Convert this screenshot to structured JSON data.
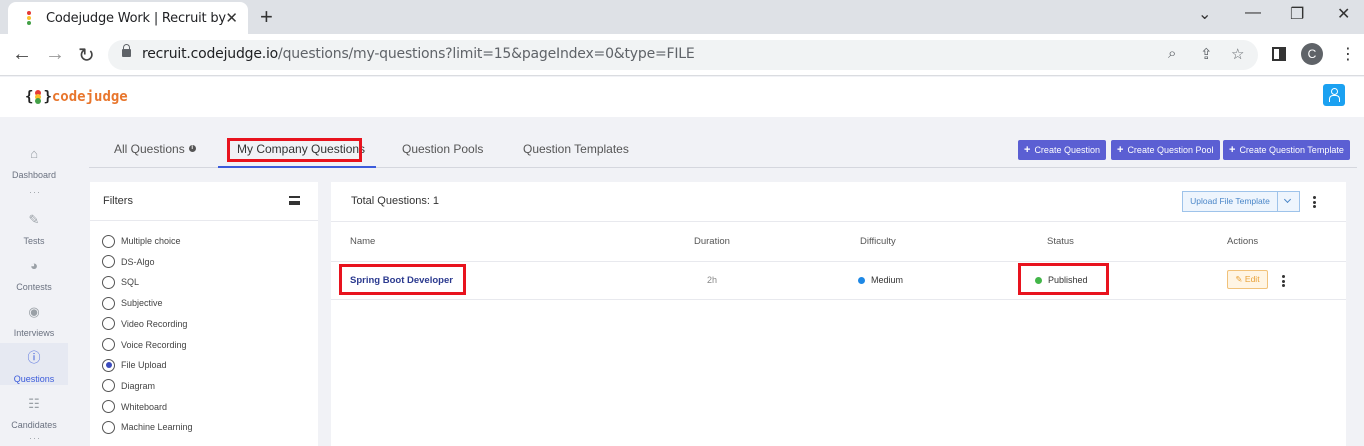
{
  "browser": {
    "tab_title": "Codejudge Work | Recruit by Real",
    "url_host": "recruit.codejudge.io",
    "url_path": "/questions/my-questions?limit=15&pageIndex=0&type=FILE",
    "profile_initial": "C"
  },
  "app": {
    "logo": {
      "brace_open": "{",
      "brace_close": "}",
      "name": "codejudge"
    }
  },
  "sidebar": {
    "items": [
      {
        "label": "Dashboard",
        "icon": "home-icon"
      },
      {
        "label": "Tests",
        "icon": "pencil-icon"
      },
      {
        "label": "Contests",
        "icon": "pie-chart-icon"
      },
      {
        "label": "Interviews",
        "icon": "location-icon"
      },
      {
        "label": "Questions",
        "icon": "question-icon",
        "active": true
      },
      {
        "label": "Candidates",
        "icon": "users-icon"
      }
    ],
    "separator": "···"
  },
  "tabs": {
    "items": [
      "All Questions",
      "My Company Questions",
      "Question Pools",
      "Question Templates"
    ],
    "active": "My Company Questions"
  },
  "actions": {
    "create_question": "Create Question",
    "create_pool": "Create Question Pool",
    "create_template": "Create Question Template",
    "plus": "+"
  },
  "filters": {
    "title": "Filters",
    "options": [
      {
        "label": "Multiple choice",
        "checked": false
      },
      {
        "label": "DS-Algo",
        "checked": false
      },
      {
        "label": "SQL",
        "checked": false
      },
      {
        "label": "Subjective",
        "checked": false
      },
      {
        "label": "Video Recording",
        "checked": false
      },
      {
        "label": "Voice Recording",
        "checked": false
      },
      {
        "label": "File Upload",
        "checked": true
      },
      {
        "label": "Diagram",
        "checked": false
      },
      {
        "label": "Whiteboard",
        "checked": false
      },
      {
        "label": "Machine Learning",
        "checked": false
      }
    ]
  },
  "table": {
    "total_label": "Total Questions: 1",
    "upload_button": "Upload File Template",
    "headers": [
      "Name",
      "Duration",
      "Difficulty",
      "Status",
      "Actions"
    ],
    "rows": [
      {
        "name": "Spring Boot Developer",
        "duration": "2h",
        "difficulty": "Medium",
        "difficulty_color": "#1e88e5",
        "status": "Published",
        "status_color": "#43b649",
        "edit_label": "Edit",
        "edit_icon": "pencil-icon"
      }
    ]
  },
  "colors": {
    "accent": "#5b5fd3",
    "highlight": "#e8131e",
    "active_nav": "#3b5bdb"
  }
}
